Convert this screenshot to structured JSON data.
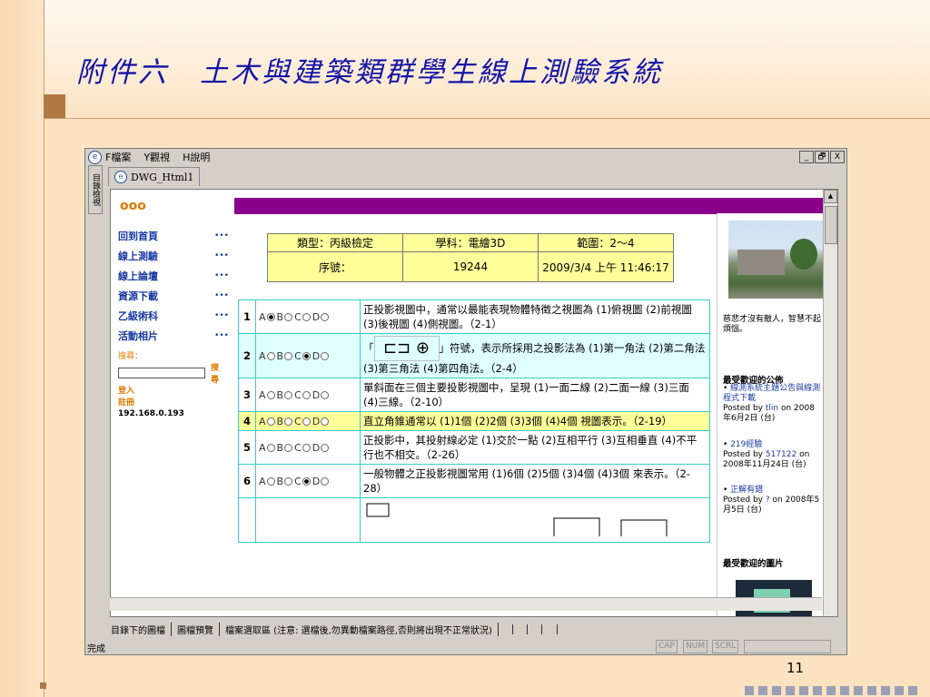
{
  "slide": {
    "title": "附件六　土木與建築類群學生線上測驗系統",
    "page_number": "11"
  },
  "window": {
    "menu": [
      "F檔案",
      "Y觀視",
      "H說明"
    ],
    "controls": [
      "_",
      "🗗",
      "X"
    ],
    "side_tab": "目錄檢視",
    "doc_tab": "DWG_Html1"
  },
  "site": {
    "logo": "ooo",
    "nav": [
      {
        "label": "回到首頁",
        "dots": "•••"
      },
      {
        "label": "線上測驗",
        "dots": "•••"
      },
      {
        "label": "線上論壇",
        "dots": "•••"
      },
      {
        "label": "資源下載",
        "dots": "•••"
      },
      {
        "label": "乙級術科",
        "dots": "•••"
      },
      {
        "label": "活動相片",
        "dots": "•••"
      }
    ],
    "search_hint": "搜尋：",
    "search_button": "搜 尋",
    "login": "登入",
    "register": "註冊",
    "ip": "192.168.0.193"
  },
  "info": {
    "type": "類型：丙級檢定",
    "subject": "學科：電繪3D",
    "range": "範圍：2～4",
    "serial_label": "序號：",
    "serial_value": "19244",
    "datetime": "2009/3/4 上午 11:46:17"
  },
  "questions": [
    {
      "num": "1",
      "selected": "A",
      "text": "正投影視圖中，通常以最能表現物體特徵之視圖為 (1)俯視圖 (2)前視圖 (3)後視圖 (4)側視圖。（2-1）"
    },
    {
      "num": "2",
      "selected": "C",
      "text_pre": "「",
      "symbol": "⊏⊐ ⊕",
      "text": "」符號，表示所採用之投影法為 (1)第一角法 (2)第二角法 (3)第三角法 (4)第四角法。（2-4）"
    },
    {
      "num": "3",
      "selected": "",
      "text": "單斜面在三個主要投影視圖中，呈現 (1)一面二線 (2)二面一線 (3)三面 (4)三線。（2-10）"
    },
    {
      "num": "4",
      "selected": "",
      "text": "直立角錐通常以 (1)1個 (2)2個 (3)3個 (4)4個 視圖表示。（2-19）"
    },
    {
      "num": "5",
      "selected": "",
      "text": "正投影中，其投射線必定 (1)交於一點 (2)互相平行 (3)互相垂直 (4)不平行也不相交。（2-26）"
    },
    {
      "num": "6",
      "selected": "C",
      "text": "一般物體之正投影視圖常用 (1)6個 (2)5個 (3)4個 (4)3個 來表示。（2-28）"
    }
  ],
  "option_letters": [
    "A",
    "B",
    "C",
    "D"
  ],
  "right_panel": {
    "quote": "慈悲才沒有敵人，智慧不起煩惱。",
    "popular_title": "最受歡迎的公佈",
    "posts": [
      {
        "title": "線測系統主題公告與線測程式下載",
        "by": "Posted by",
        "author": "tlin",
        "date": "on 2008年6月2日 (台)"
      },
      {
        "title": "219經驗",
        "by": "Posted by",
        "author": "517122",
        "date": "on 2008年11月24日 (台)"
      },
      {
        "title": "正解有錯",
        "by": "Posted by",
        "author": "?",
        "date": "on 2008年5月5日 (台)"
      }
    ],
    "photo_title": "最受歡迎的圖片"
  },
  "bottom_tabs": [
    "目錄下的圖檔",
    "圖檔預覽",
    "檔案選取區 (注意: 選檔後,勿異動檔案路徑,否則將出現不正常狀況)",
    "",
    "",
    "",
    ""
  ],
  "status": {
    "text": "完成",
    "panels": [
      "CAP",
      "NUM",
      "SCRL",
      ""
    ]
  }
}
